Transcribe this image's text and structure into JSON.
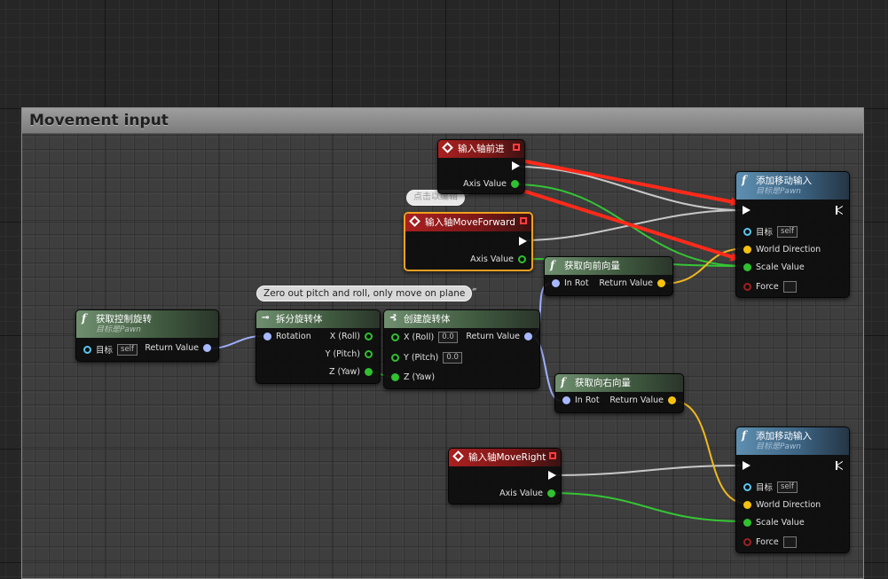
{
  "comment": {
    "title": "Movement input"
  },
  "bubbles": {
    "click_to_edit": "点击以编辑",
    "zero_out": "Zero out pitch and roll, only move on plane"
  },
  "nodes": {
    "get_control_rotation": {
      "title": "获取控制旋转",
      "subtitle": "目标是Pawn",
      "pins": {
        "target": "目标",
        "target_value": "self",
        "return_value": "Return Value"
      }
    },
    "break_rotator": {
      "title": "拆分旋转体",
      "pins": {
        "rotation": "Rotation",
        "x": "X (Roll)",
        "y": "Y (Pitch)",
        "z": "Z (Yaw)"
      }
    },
    "make_rotator": {
      "title": "创建旋转体",
      "pins": {
        "x": "X (Roll)",
        "x_value": "0.0",
        "y": "Y (Pitch)",
        "y_value": "0.0",
        "z": "Z (Yaw)",
        "return_value": "Return Value"
      }
    },
    "input_axis_forward_cn": {
      "title": "输入轴前进",
      "pins": {
        "axis_value": "Axis Value"
      }
    },
    "input_axis_moveforward": {
      "title": "输入轴MoveForward",
      "pins": {
        "axis_value": "Axis Value"
      }
    },
    "get_forward_vector": {
      "title": "获取向前向量",
      "pins": {
        "in_rot": "In Rot",
        "return_value": "Return Value"
      }
    },
    "get_right_vector": {
      "title": "获取向右向量",
      "pins": {
        "in_rot": "In Rot",
        "return_value": "Return Value"
      }
    },
    "input_axis_moveright": {
      "title": "输入轴MoveRight",
      "pins": {
        "axis_value": "Axis Value"
      }
    },
    "add_movement_input_1": {
      "title": "添加移动输入",
      "subtitle": "目标是Pawn",
      "pins": {
        "target": "目标",
        "target_value": "self",
        "world_direction": "World Direction",
        "scale_value": "Scale Value",
        "force": "Force"
      }
    },
    "add_movement_input_2": {
      "title": "添加移动输入",
      "subtitle": "目标是Pawn",
      "pins": {
        "target": "目标",
        "target_value": "self",
        "world_direction": "World Direction",
        "scale_value": "Scale Value",
        "force": "Force"
      }
    }
  },
  "colors": {
    "exec_wire": "#c8c8c8",
    "float_wire": "#35c435",
    "vector_wire": "#f0b820",
    "rotator_wire": "#9fb0ff",
    "annotation_arrow": "#ff2a1a",
    "selection_outline": "#f0a020"
  }
}
